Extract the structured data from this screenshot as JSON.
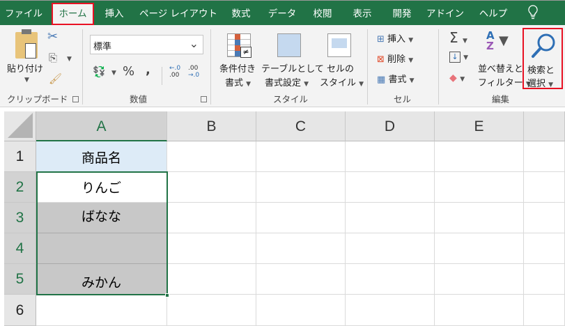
{
  "tabs": [
    {
      "label": "ファイル"
    },
    {
      "label": "ホーム",
      "selected": true
    },
    {
      "label": "挿入"
    },
    {
      "label": "ページ レイアウト"
    },
    {
      "label": "数式"
    },
    {
      "label": "データ"
    },
    {
      "label": "校閲"
    },
    {
      "label": "表示"
    },
    {
      "label": "開発"
    },
    {
      "label": "アドイン"
    },
    {
      "label": "ヘルプ"
    }
  ],
  "tell_me_icon": "lightbulb-icon",
  "ribbon": {
    "clipboard": {
      "paste": "貼り付け",
      "group": "クリップボード"
    },
    "number": {
      "format": "標準",
      "percent": "%",
      "comma": ",",
      "inc_decimal_top": "←.0",
      "inc_decimal_bottom": ".00",
      "dec_decimal_top": ".00",
      "dec_decimal_bottom": "→.0",
      "group": "数値"
    },
    "styles": {
      "conditional_1": "条件付き",
      "conditional_2": "書式",
      "table_1": "テーブルとして",
      "table_2": "書式設定",
      "cell_1": "セルの",
      "cell_2": "スタイル",
      "group": "スタイル"
    },
    "cells": {
      "insert": "挿入",
      "delete": "削除",
      "format": "書式",
      "group": "セル"
    },
    "editing": {
      "sum": "Σ",
      "sort_1": "並べ替えと",
      "sort_2": "フィルター",
      "find_1": "検索と",
      "find_2": "選択",
      "group": "編集"
    }
  },
  "columns": [
    "A",
    "B",
    "C",
    "D",
    "E"
  ],
  "rows": [
    "1",
    "2",
    "3",
    "4",
    "5",
    "6"
  ],
  "cells": {
    "A1": "商品名",
    "A2": "りんご",
    "A3": "ばなな",
    "A4": "",
    "A5": "みかん"
  },
  "colors": {
    "accent": "#217346",
    "highlight_red": "#e81123",
    "header_fill": "#ddebf7",
    "selected_fill": "#c8c8c8"
  }
}
